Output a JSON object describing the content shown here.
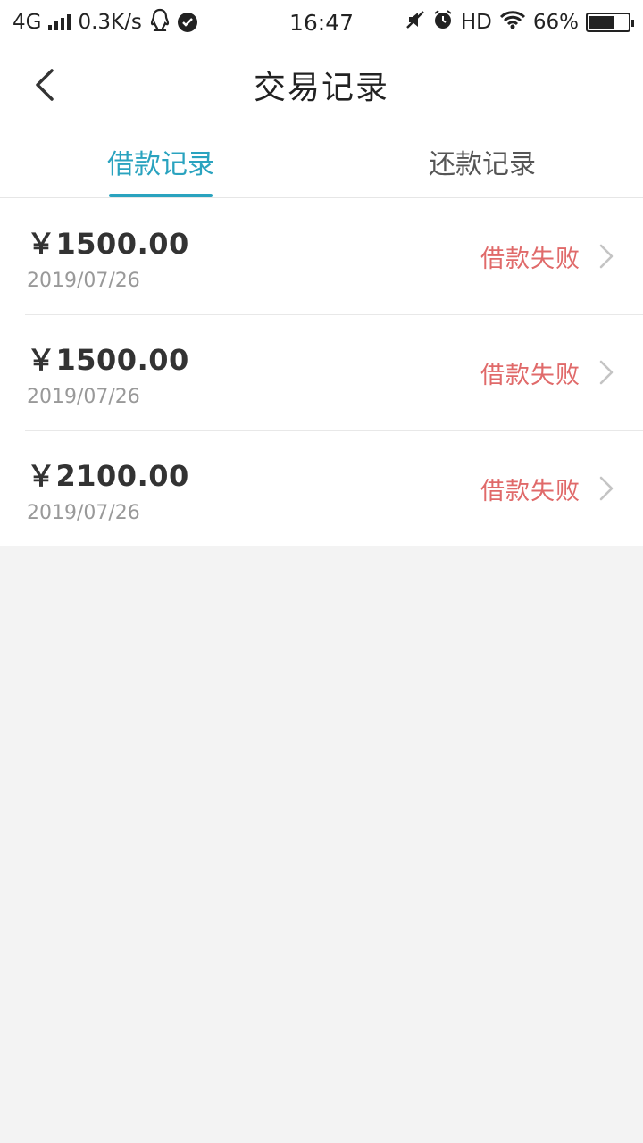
{
  "status_bar": {
    "network": "4G",
    "speed": "0.3K/s",
    "time": "16:47",
    "hd": "HD",
    "battery": "66%",
    "battery_level": 0.66
  },
  "nav": {
    "title": "交易记录"
  },
  "tabs": [
    {
      "label": "借款记录",
      "active": true
    },
    {
      "label": "还款记录",
      "active": false
    }
  ],
  "records": [
    {
      "amount": "￥1500.00",
      "date": "2019/07/26",
      "status": "借款失败"
    },
    {
      "amount": "￥1500.00",
      "date": "2019/07/26",
      "status": "借款失败"
    },
    {
      "amount": "￥2100.00",
      "date": "2019/07/26",
      "status": "借款失败"
    }
  ],
  "colors": {
    "accent": "#2aa3bf",
    "status_fail": "#e06a6a",
    "background": "#f3f3f3"
  }
}
